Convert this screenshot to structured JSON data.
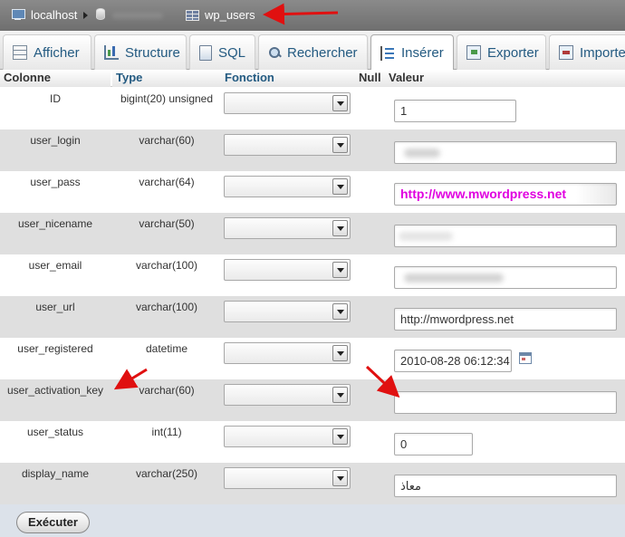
{
  "breadcrumb": {
    "server": "localhost",
    "server_icon": "server-icon",
    "database_icon": "database-icon",
    "table": "wp_users",
    "table_icon": "table-icon"
  },
  "tabs": [
    {
      "label": "Afficher",
      "icon": "browse-icon",
      "active": false
    },
    {
      "label": "Structure",
      "icon": "structure-icon",
      "active": false
    },
    {
      "label": "SQL",
      "icon": "sql-icon",
      "active": false
    },
    {
      "label": "Rechercher",
      "icon": "search-icon",
      "active": false
    },
    {
      "label": "Insérer",
      "icon": "insert-icon",
      "active": true
    },
    {
      "label": "Exporter",
      "icon": "export-icon",
      "active": false
    },
    {
      "label": "Importe",
      "icon": "import-icon",
      "active": false
    }
  ],
  "table": {
    "headers": {
      "column": "Colonne",
      "type": "Type",
      "function": "Fonction",
      "null": "Null",
      "value": "Valeur"
    },
    "rows": [
      {
        "column": "ID",
        "type": "bigint(20) unsigned",
        "value": "1"
      },
      {
        "column": "user_login",
        "type": "varchar(60)",
        "value": ""
      },
      {
        "column": "user_pass",
        "type": "varchar(64)",
        "value": "http://www.mwordpress.net"
      },
      {
        "column": "user_nicename",
        "type": "varchar(50)",
        "value": ""
      },
      {
        "column": "user_email",
        "type": "varchar(100)",
        "value": ""
      },
      {
        "column": "user_url",
        "type": "varchar(100)",
        "value": "http://mwordpress.net"
      },
      {
        "column": "user_registered",
        "type": "datetime",
        "value": "2010-08-28 06:12:34"
      },
      {
        "column": "user_activation_key",
        "type": "varchar(60)",
        "value": ""
      },
      {
        "column": "user_status",
        "type": "int(11)",
        "value": "0"
      },
      {
        "column": "display_name",
        "type": "varchar(250)",
        "value": "معاذ"
      }
    ]
  },
  "footer": {
    "go_label": "Exécuter"
  },
  "colors": {
    "link_blue": "#235a81",
    "annotation_red": "#e01010",
    "highlight_text": "#e000e0",
    "row_alt": "#dfdfdf",
    "footer_bg": "#dce2ea"
  }
}
